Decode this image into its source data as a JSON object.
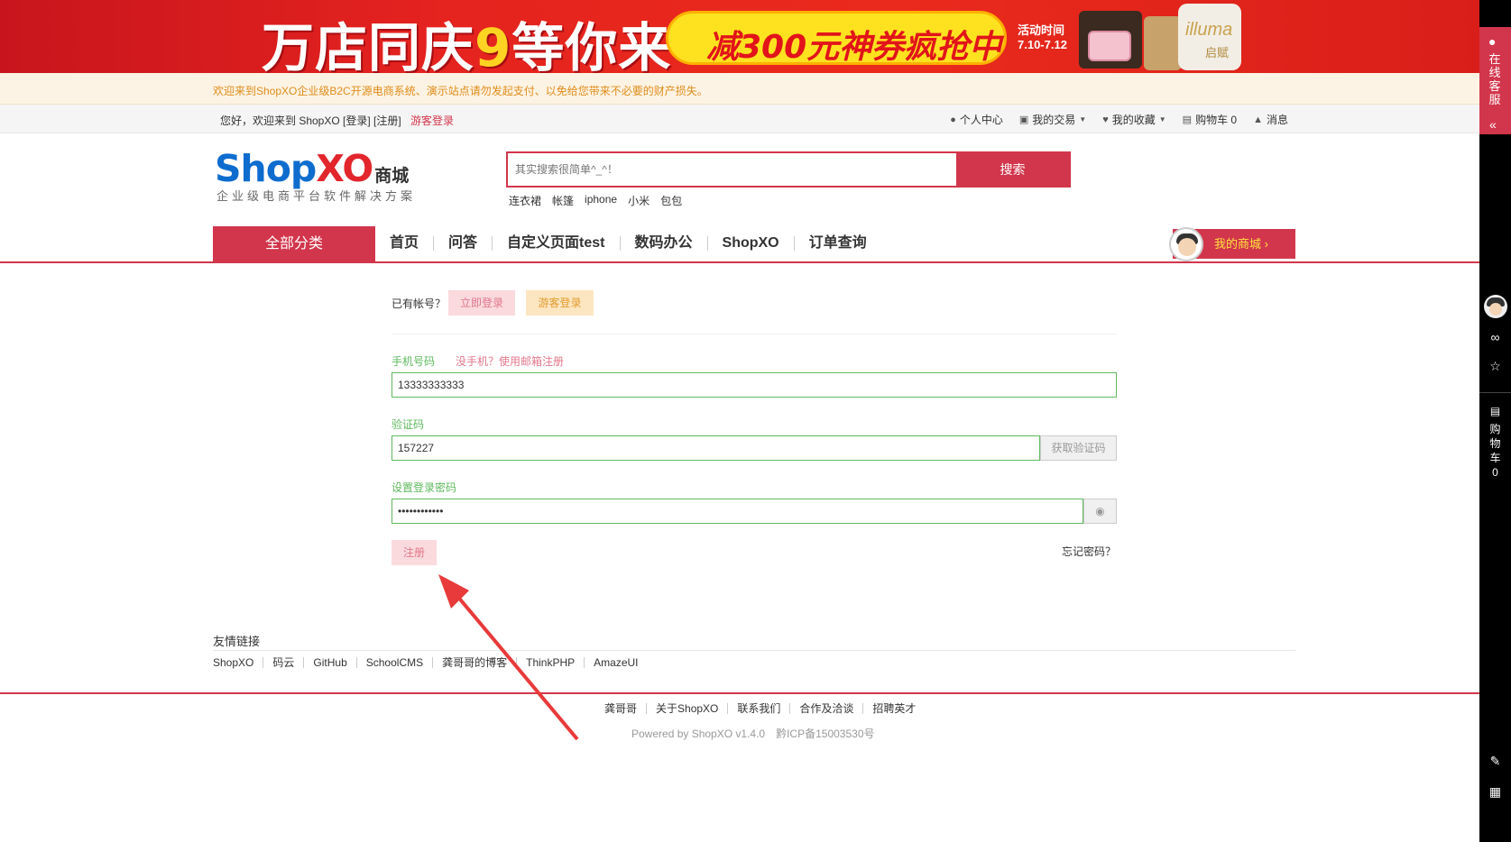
{
  "banner": {
    "title_a": "万店同庆",
    "title_b": "9",
    "title_c": "等你来",
    "promo": "减300元神券疯抢中",
    "time_label": "活动时间",
    "time_range": "7.10-7.12",
    "product_text": "illuma",
    "product_sub": "启赋"
  },
  "notice": {
    "text": "欢迎来到ShopXO企业级B2C开源电商系统、演示站点请勿发起支付、以免给您带来不必要的财产损失。"
  },
  "topbar": {
    "welcome": "您好，欢迎来到 ShopXO [登录] [注册]",
    "guest_login": "游客登录",
    "links": [
      {
        "icon": "user-icon",
        "label": "个人中心"
      },
      {
        "icon": "cube-icon",
        "label": "我的交易"
      },
      {
        "icon": "heart-icon",
        "label": "我的收藏"
      },
      {
        "icon": "cart-icon",
        "label": "购物车 0"
      },
      {
        "icon": "bell-icon",
        "label": "消息"
      }
    ]
  },
  "header": {
    "logo_shop": "Shop",
    "logo_xo": "XO",
    "logo_mall": "商城",
    "slogan": "企业级电商平台软件解决方案",
    "search_placeholder": "其实搜索很简单^_^！",
    "search_button": "搜索",
    "hot_words": [
      "连衣裙",
      "帐篷",
      "iphone",
      "小米",
      "包包"
    ]
  },
  "nav": {
    "all_categories": "全部分类",
    "items": [
      "首页",
      "问答",
      "自定义页面test",
      "数码办公",
      "ShopXO",
      "订单查询"
    ],
    "my_mall": "我的商城"
  },
  "form": {
    "have_account": "已有帐号？",
    "login_now": "立即登录",
    "guest_login": "游客登录",
    "phone_label": "手机号码",
    "email_link": "没手机？使用邮箱注册",
    "phone_value": "13333333333",
    "code_label": "验证码",
    "code_value": "157227",
    "get_code": "获取验证码",
    "password_label": "设置登录密码",
    "password_value": "••••••••••••",
    "register_button": "注册",
    "forgot_password": "忘记密码？"
  },
  "friend_links": {
    "title": "友情链接",
    "items": [
      "ShopXO",
      "码云",
      "GitHub",
      "SchoolCMS",
      "龚哥哥的博客",
      "ThinkPHP",
      "AmazeUI"
    ]
  },
  "footer": {
    "links": [
      "龚哥哥",
      "关于ShopXO",
      "联系我们",
      "合作及洽谈",
      "招聘英才"
    ],
    "powered": "Powered by ShopXO v1.4.0",
    "icp": "黔ICP备15003530号"
  },
  "sidebar": {
    "service": "在线客服",
    "cart_label": "购物车",
    "cart_count": "0"
  },
  "colors": {
    "brand_red": "#d2364c",
    "success_green": "#5eb95e",
    "notice_orange": "#e08c1b"
  }
}
